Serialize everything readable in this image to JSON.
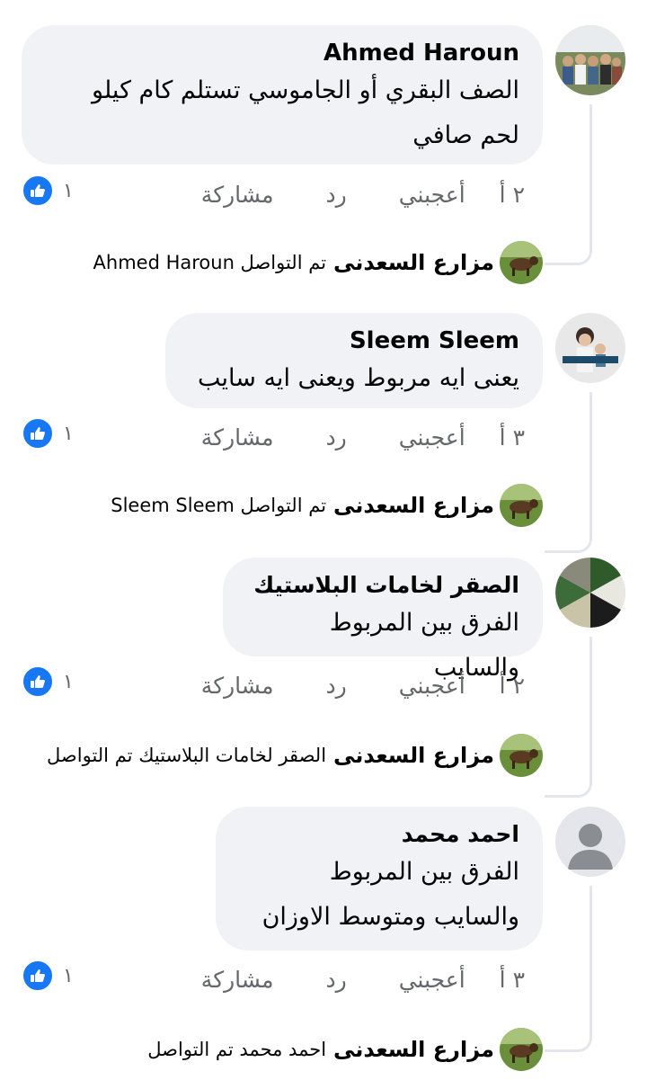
{
  "comments": [
    {
      "author": "Ahmed Haroun",
      "text": "الصف البقري أو الجاموسي تستلم كام كيلو لحم صافي",
      "time": "٢ أ",
      "like_label": "أعجبني",
      "reply_label": "رد",
      "share_label": "مشاركة",
      "reaction_count": "١",
      "reply": {
        "author": "مزارع السعدنى",
        "text": "تم التواصل Ahmed Haroun"
      }
    },
    {
      "author": "Sleem Sleem",
      "text": "يعنى ايه مربوط ويعنى ايه سايب",
      "time": "٣ أ",
      "like_label": "أعجبني",
      "reply_label": "رد",
      "share_label": "مشاركة",
      "reaction_count": "١",
      "reply": {
        "author": "مزارع السعدنى",
        "text": "تم التواصل Sleem Sleem"
      }
    },
    {
      "author": "الصقر لخامات البلاستيك",
      "text": "الفرق بين المربوط والسايب",
      "time": "٢ أ",
      "like_label": "أعجبني",
      "reply_label": "رد",
      "share_label": "مشاركة",
      "reaction_count": "١",
      "reply": {
        "author": "مزارع السعدنى",
        "text": "الصقر لخامات البلاستيك تم التواصل"
      }
    },
    {
      "author": "احمد محمد",
      "text": "الفرق بين المربوط والسايب ومتوسط الاوزان",
      "time": "٣ أ",
      "like_label": "أعجبني",
      "reply_label": "رد",
      "share_label": "مشاركة",
      "reaction_count": "١",
      "reply": {
        "author": "مزارع السعدنى",
        "text": "احمد محمد تم التواصل"
      }
    }
  ],
  "colors": {
    "bubble": "#f0f2f5",
    "like_blue": "#1877f2",
    "meta_gray": "#65676b",
    "thread_line": "#e4e6eb"
  }
}
